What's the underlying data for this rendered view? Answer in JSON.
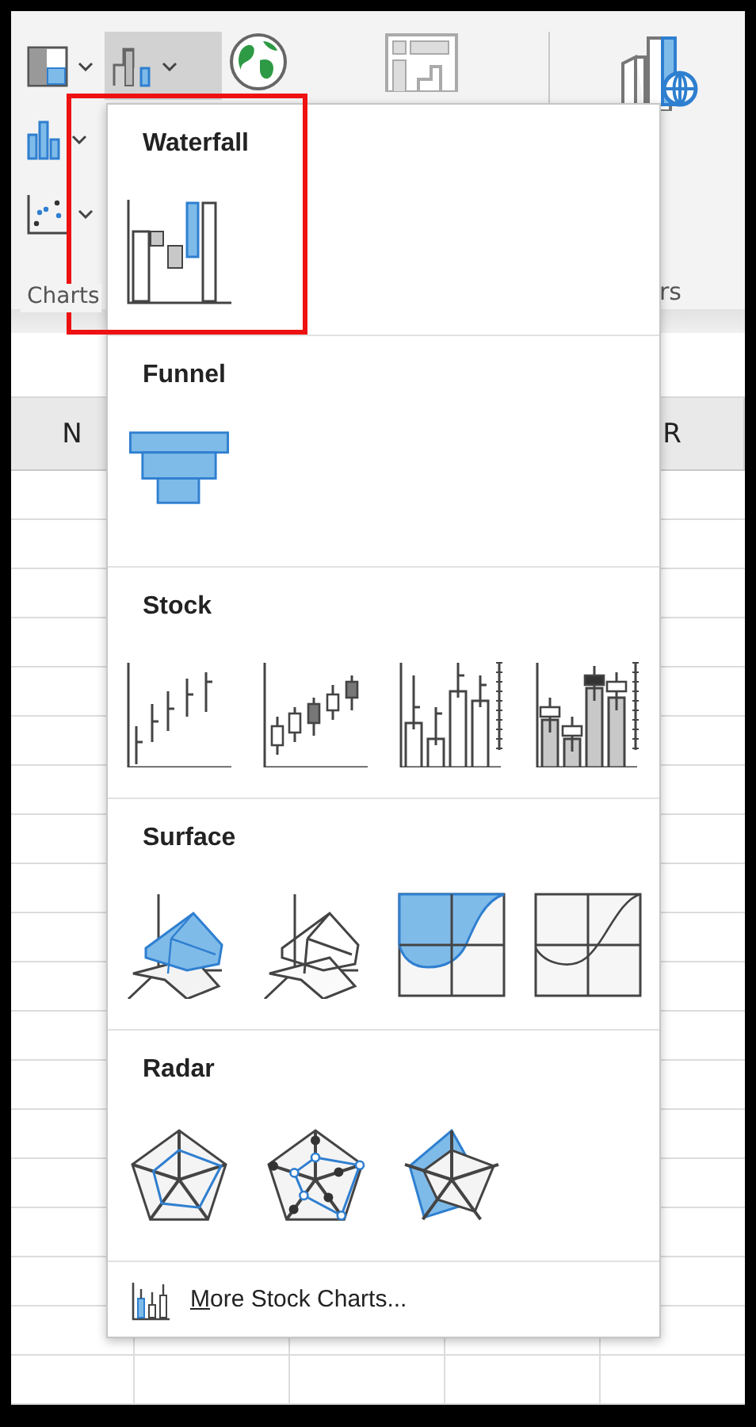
{
  "ribbon": {
    "groups": [
      {
        "label": "Charts",
        "buttons": [
          {
            "kind": "table-chart",
            "dropdown": true,
            "selected": false
          },
          {
            "kind": "waterfall",
            "dropdown": true,
            "selected": true
          },
          {
            "kind": "column",
            "dropdown": true,
            "selected": false
          },
          {
            "kind": "scatter",
            "dropdown": true,
            "selected": false
          },
          {
            "kind": "map",
            "dropdown": false,
            "selected": false
          },
          {
            "kind": "pivot-chart",
            "dropdown": false,
            "selected": false
          }
        ]
      },
      {
        "label": "rs",
        "buttons": [
          {
            "kind": "map3d",
            "dropdown": false,
            "selected": false
          }
        ]
      }
    ]
  },
  "sheet": {
    "columns": [
      "N",
      "R"
    ]
  },
  "menu": {
    "sections": [
      {
        "title": "Waterfall",
        "highlighted": true,
        "charts": [
          {
            "kind": "waterfall"
          }
        ]
      },
      {
        "title": "Funnel",
        "highlighted": false,
        "charts": [
          {
            "kind": "funnel"
          }
        ]
      },
      {
        "title": "Stock",
        "highlighted": false,
        "charts": [
          {
            "kind": "hlc"
          },
          {
            "kind": "ohlc"
          },
          {
            "kind": "vhlc"
          },
          {
            "kind": "vohlc"
          }
        ]
      },
      {
        "title": "Surface",
        "highlighted": false,
        "charts": [
          {
            "kind": "surface-3d"
          },
          {
            "kind": "wireframe-3d"
          },
          {
            "kind": "contour"
          },
          {
            "kind": "wireframe-contour"
          }
        ]
      },
      {
        "title": "Radar",
        "highlighted": false,
        "charts": [
          {
            "kind": "radar"
          },
          {
            "kind": "radar-markers"
          },
          {
            "kind": "radar-filled"
          }
        ]
      }
    ],
    "footer": {
      "label": "More Stock Charts..."
    }
  }
}
